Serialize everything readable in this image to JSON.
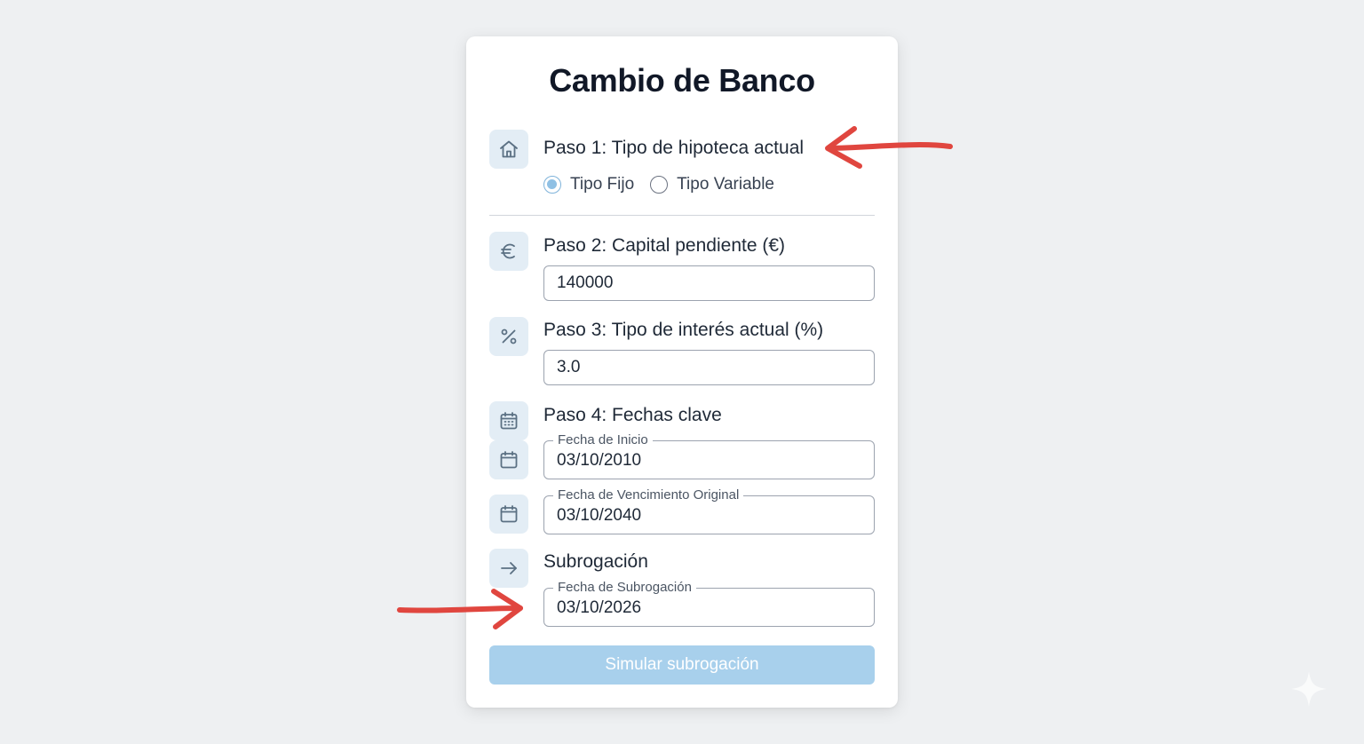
{
  "title": "Cambio de Banco",
  "step1": {
    "label": "Paso 1: Tipo de hipoteca actual",
    "icon": "home-icon",
    "options": [
      {
        "label": "Tipo Fijo",
        "selected": true
      },
      {
        "label": "Tipo Variable",
        "selected": false
      }
    ]
  },
  "step2": {
    "label": "Paso 2: Capital pendiente (€)",
    "icon": "euro-icon",
    "value": "140000"
  },
  "step3": {
    "label": "Paso 3: Tipo de interés actual (%)",
    "icon": "percent-icon",
    "value": "3.0"
  },
  "step4": {
    "label": "Paso 4: Fechas clave",
    "icon": "calendar-icon",
    "start": {
      "legend": "Fecha de Inicio",
      "value": "03/10/2010"
    },
    "maturity": {
      "legend": "Fecha de Vencimiento Original",
      "value": "03/10/2040"
    }
  },
  "subrogation": {
    "label": "Subrogación",
    "icon": "arrow-right-icon",
    "date": {
      "legend": "Fecha de Subrogación",
      "value": "03/10/2026"
    }
  },
  "submit_label": "Simular subrogación",
  "colors": {
    "accent": "#a8d0ec",
    "radio_selected": "#8fc0e4",
    "annotation_arrow": "#e0463f",
    "icon_bg": "#e3edf5"
  }
}
